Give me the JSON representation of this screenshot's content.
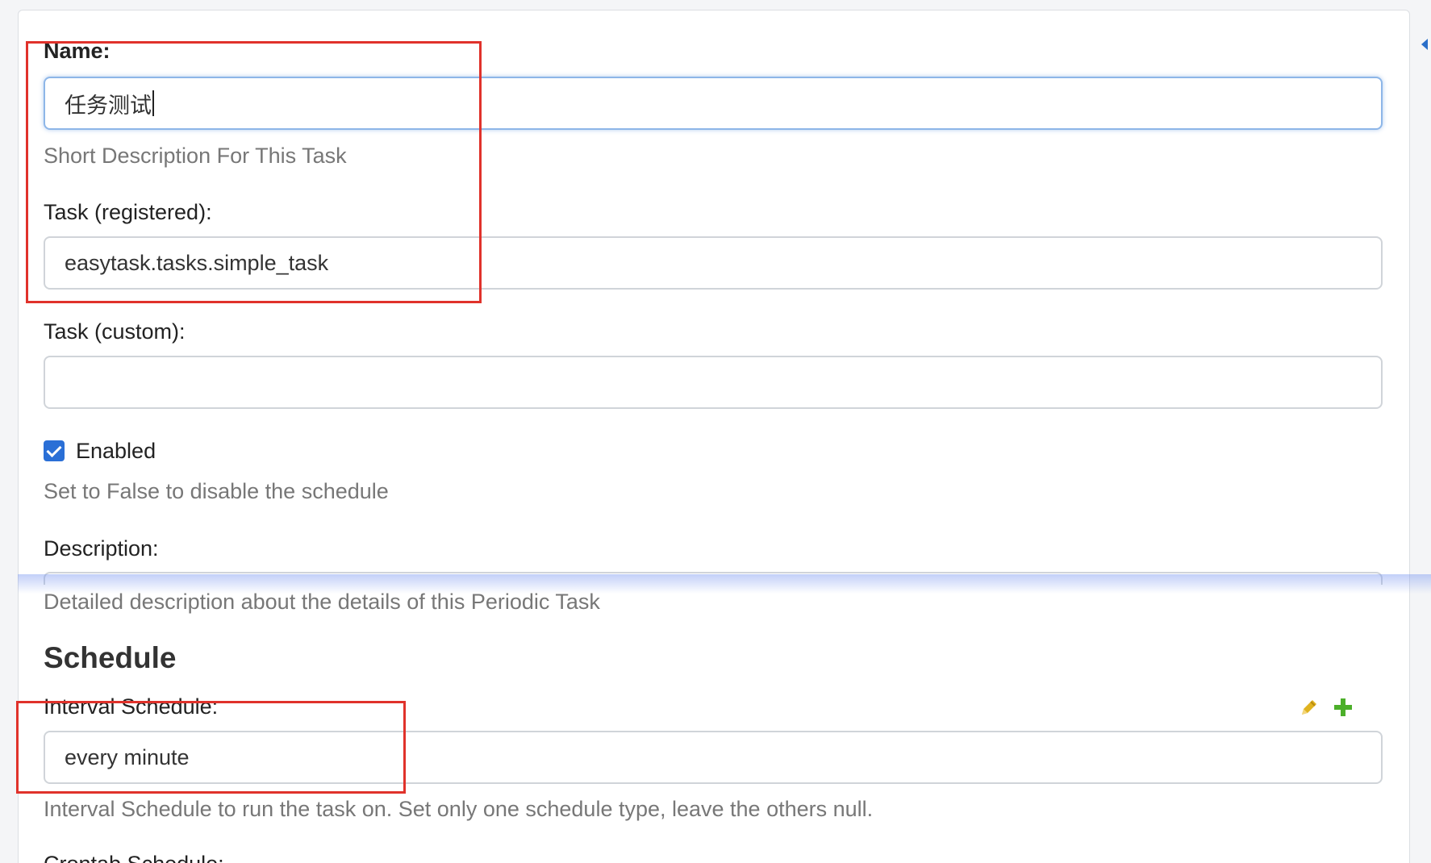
{
  "form": {
    "name": {
      "label": "Name:",
      "value": "任务测试",
      "help": "Short Description For This Task"
    },
    "task_registered": {
      "label": "Task (registered):",
      "value": "easytask.tasks.simple_task"
    },
    "task_custom": {
      "label": "Task (custom):",
      "value": ""
    },
    "enabled": {
      "label": "Enabled",
      "checked": true,
      "help": "Set to False to disable the schedule"
    },
    "description": {
      "label": "Description:",
      "help": "Detailed description about the details of this Periodic Task"
    },
    "schedule": {
      "title": "Schedule",
      "interval": {
        "label": "Interval Schedule:",
        "value": "every minute",
        "help": "Interval Schedule to run the task on.  Set only one schedule type, leave the others null.",
        "edit_icon": "pencil-icon",
        "add_icon": "plus-icon"
      },
      "crontab": {
        "label": "Crontab Schedule:"
      }
    }
  },
  "colors": {
    "highlight_box": "#e0322b",
    "checkbox": "#2a6fd6",
    "add_icon": "#4caf2a",
    "edit_icon": "#e0b320",
    "focus_border": "#8db6e8"
  }
}
